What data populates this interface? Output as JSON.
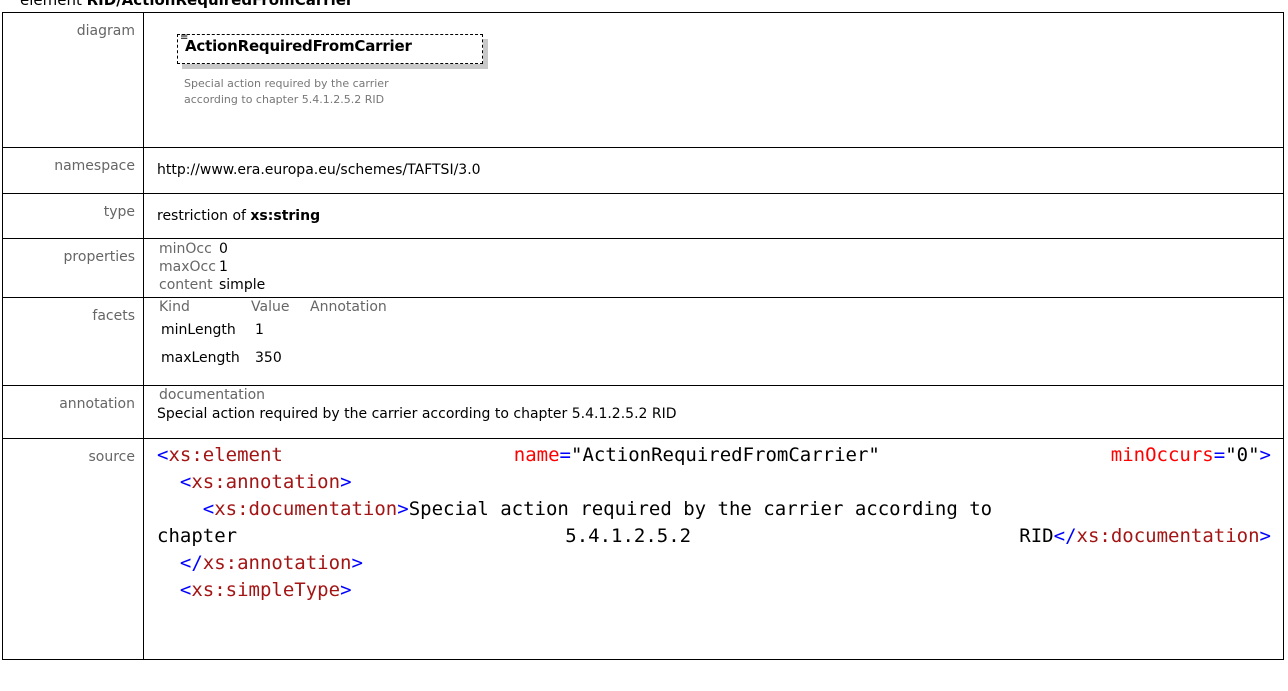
{
  "page_title": {
    "prefix": "element ",
    "name": "RID/ActionRequiredFromCarrier"
  },
  "labels": {
    "diagram": "diagram",
    "namespace": "namespace",
    "type": "type",
    "properties": "properties",
    "facets": "facets",
    "annotation": "annotation",
    "source": "source"
  },
  "diagram": {
    "element_name": "ActionRequiredFromCarrier",
    "caption_line1": "Special action required by the carrier",
    "caption_line2": "according to chapter 5.4.1.2.5.2 RID",
    "doc_icon": "doc-lines-icon"
  },
  "namespace": "http://www.era.europa.eu/schemes/TAFTSI/3.0",
  "type": {
    "prefix": "restriction of ",
    "base": "xs:string"
  },
  "properties": [
    {
      "key": "minOcc",
      "value": "0"
    },
    {
      "key": "maxOcc",
      "value": "1"
    },
    {
      "key": "content",
      "value": "simple"
    }
  ],
  "facets": {
    "headers": [
      "Kind",
      "Value",
      "Annotation"
    ],
    "rows": [
      {
        "kind": "minLength",
        "value": "1"
      },
      {
        "kind": "maxLength",
        "value": "350"
      }
    ]
  },
  "annotation": {
    "heading": "documentation",
    "text": "Special action required by the carrier according to chapter 5.4.1.2.5.2 RID"
  },
  "source": {
    "l1_tag": "xs:element",
    "l1_attr1": "name",
    "l1_val1": "\"ActionRequiredFromCarrier\"",
    "l1_attr2": "minOccurs",
    "l1_val2": "\"0\"",
    "l2_tag": "xs:annotation",
    "l3_tag": "xs:documentation",
    "l3_text": "Special action required by the carrier according to",
    "l4_w1": "chapter",
    "l4_w2": "5.4.1.2.5.2",
    "l4_w3": "RID",
    "l4_endtag": "xs:documentation",
    "l5_endtag": "xs:annotation",
    "l6_tag": "xs:simpleType"
  },
  "colors": {
    "tag": "#0000ff",
    "tag_name": "#a31515",
    "attribute": "#ff0000",
    "label": "#666666"
  }
}
